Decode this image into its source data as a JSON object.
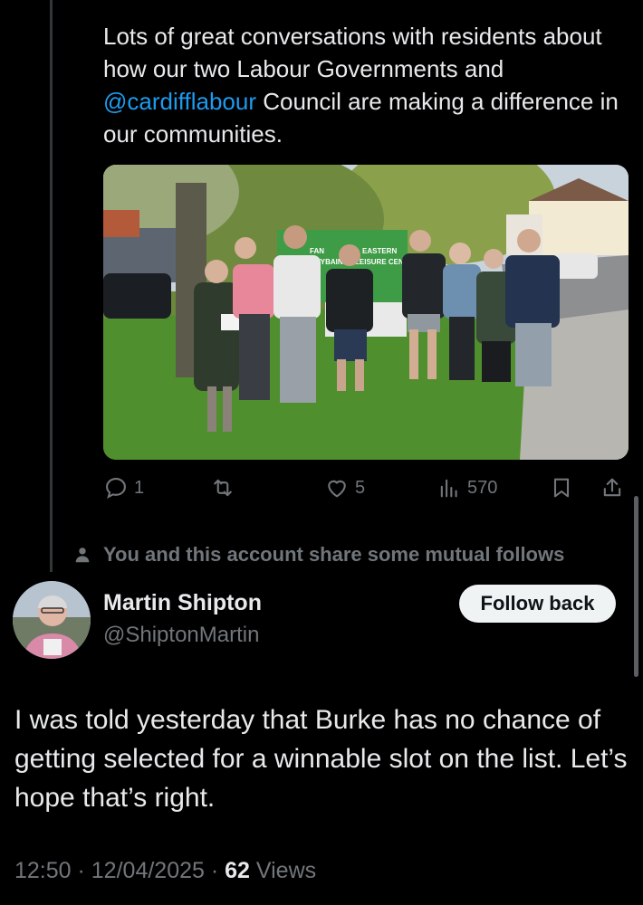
{
  "quoted_tweet": {
    "text_before": "Lots of great conversations with residents about how our two Labour Governments and ",
    "mention": "@cardifflabour",
    "text_after": " Council are making a difference in our communities.",
    "photo": {
      "sign_line_1": "FAN",
      "sign_line_2": "OWYBAIN",
      "sign_line_3": "EASTERN",
      "sign_line_4": "LEISURE CENTRE"
    },
    "actions": {
      "replies": "1",
      "likes": "5",
      "views": "570"
    }
  },
  "mutual_notice": "You and this account share some mutual follows",
  "reply_tweet": {
    "author_name": "Martin Shipton",
    "author_handle": "@ShiptonMartin",
    "follow_label": "Follow back",
    "text": "I was told yesterday that Burke has no chance of getting selected for a winnable slot on the list. Let’s hope that’s right.",
    "time": "12:50",
    "date": "12/04/2025",
    "views_count": "62",
    "views_label": "Views",
    "separator": " · "
  }
}
